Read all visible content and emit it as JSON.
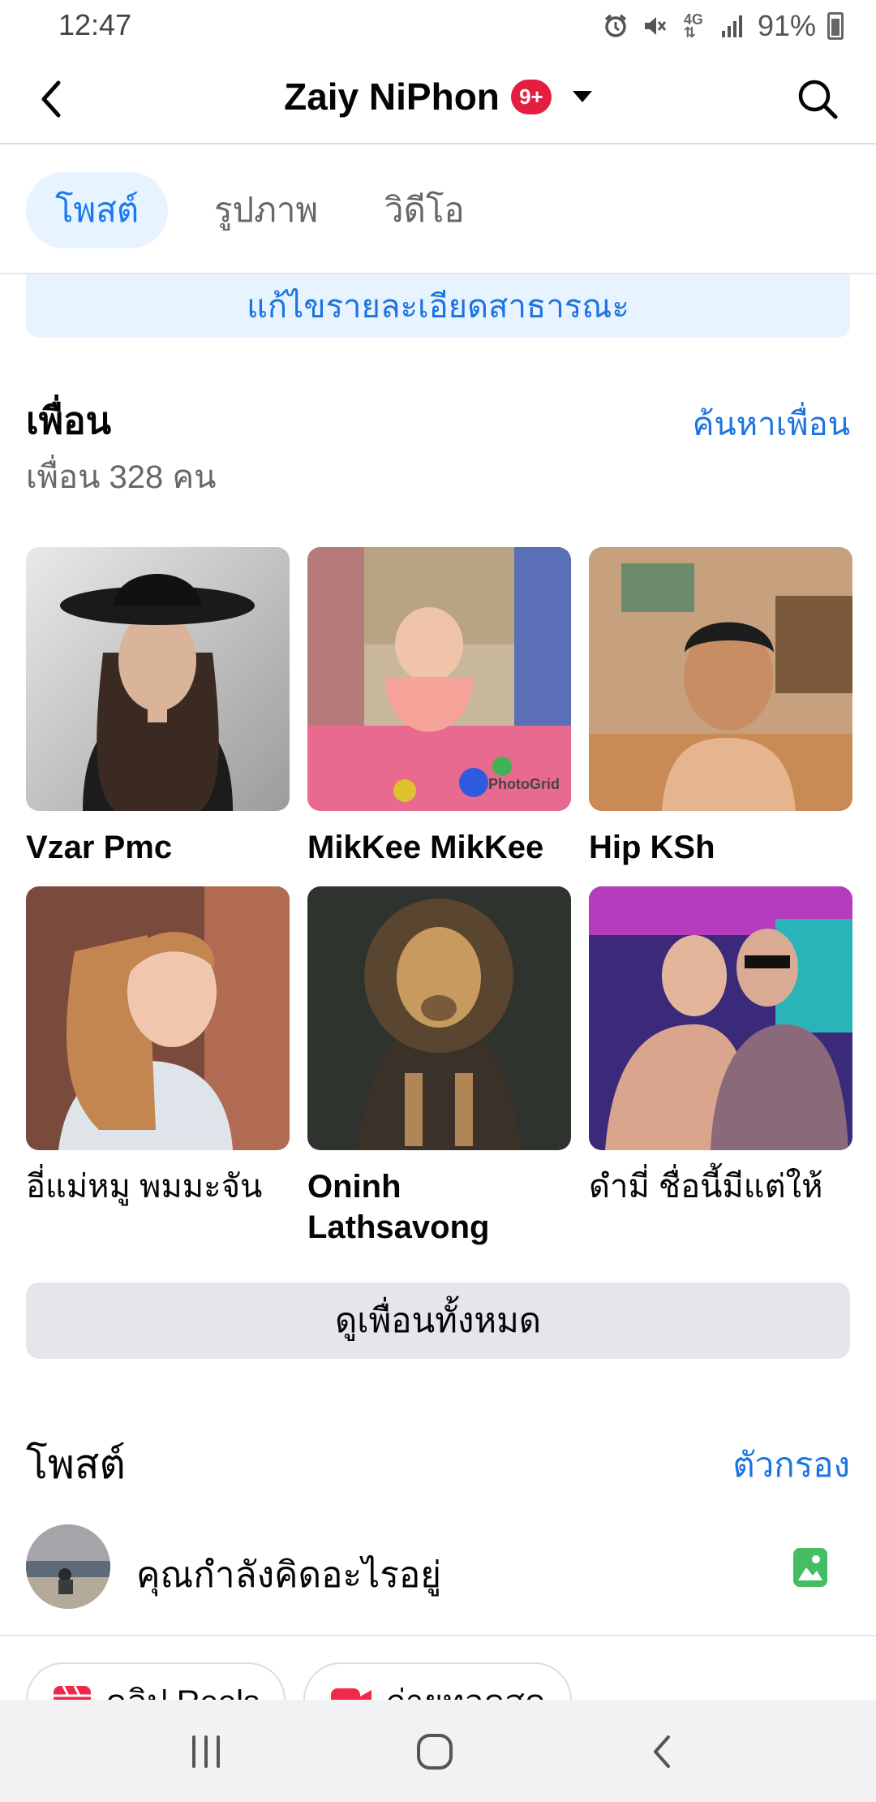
{
  "status": {
    "time": "12:47",
    "battery": "91%"
  },
  "header": {
    "title": "Zaiy NiPhon",
    "badge": "9+"
  },
  "tabs": [
    {
      "label": "โพสต์",
      "active": true
    },
    {
      "label": "รูปภาพ",
      "active": false
    },
    {
      "label": "วิดีโอ",
      "active": false
    }
  ],
  "edit_public_details": "แก้ไขรายละเอียดสาธารณะ",
  "friends": {
    "title": "เพื่อน",
    "find_label": "ค้นหาเพื่อน",
    "count_text": "เพื่อน 328 คน",
    "items": [
      {
        "name": "Vzar Pmc"
      },
      {
        "name": "MikKee MikKee",
        "photo_watermark": "PhotoGrid"
      },
      {
        "name": "Hip KSh"
      },
      {
        "name": "อี่แม่หมู พมมะจัน"
      },
      {
        "name": "Oninh Lathsavong"
      },
      {
        "name": "ดำมี่ ชื่อนี้มีแต่ให้"
      }
    ],
    "see_all_label": "ดูเพื่อนทั้งหมด"
  },
  "posts": {
    "title": "โพสต์",
    "filter_label": "ตัวกรอง",
    "composer_placeholder": "คุณกำลังคิดอะไรอยู่",
    "chips": [
      {
        "label": "คลิป Reels",
        "icon": "reels-icon"
      },
      {
        "label": "ถ่ายทอดสด",
        "icon": "live-video-icon"
      }
    ]
  },
  "colors": {
    "accent": "#1b74e4",
    "badge": "#e41e3f",
    "photo_icon": "#45bd62"
  }
}
